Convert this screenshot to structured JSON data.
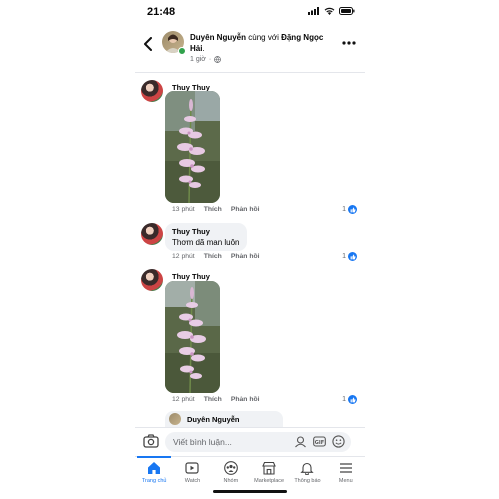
{
  "status_bar": {
    "time": "21:48"
  },
  "post_header": {
    "author": "Duyên Nguyễn",
    "with_text": "cùng với",
    "tagged": "Đặng Ngọc Hải",
    "trailing": ".",
    "time": "1 giờ"
  },
  "comments": [
    {
      "name": "Thuy Thuy",
      "type": "photo",
      "time": "13 phút",
      "like_label": "Thích",
      "reply_label": "Phản hồi",
      "likes": "1"
    },
    {
      "name": "Thuy Thuy",
      "type": "text",
      "text": "Thơm dã man luôn",
      "time": "12 phút",
      "like_label": "Thích",
      "reply_label": "Phản hồi",
      "likes": "1"
    },
    {
      "name": "Thuy Thuy",
      "type": "photo",
      "time": "12 phút",
      "like_label": "Thích",
      "reply_label": "Phản hồi",
      "likes": "1"
    }
  ],
  "reply_preview": {
    "name": "Duyên Nguyễn"
  },
  "composer": {
    "placeholder": "Viết bình luận..."
  },
  "tabs": [
    {
      "label": "Trang chủ",
      "icon": "home-icon",
      "active": true
    },
    {
      "label": "Watch",
      "icon": "watch-icon"
    },
    {
      "label": "Nhóm",
      "icon": "groups-icon"
    },
    {
      "label": "Marketplace",
      "icon": "marketplace-icon"
    },
    {
      "label": "Thông báo",
      "icon": "bell-icon"
    },
    {
      "label": "Menu",
      "icon": "menu-icon"
    }
  ],
  "colors": {
    "accent": "#1877f2",
    "bubble": "#f0f2f5",
    "muted": "#65676b",
    "online": "#31a24c"
  }
}
